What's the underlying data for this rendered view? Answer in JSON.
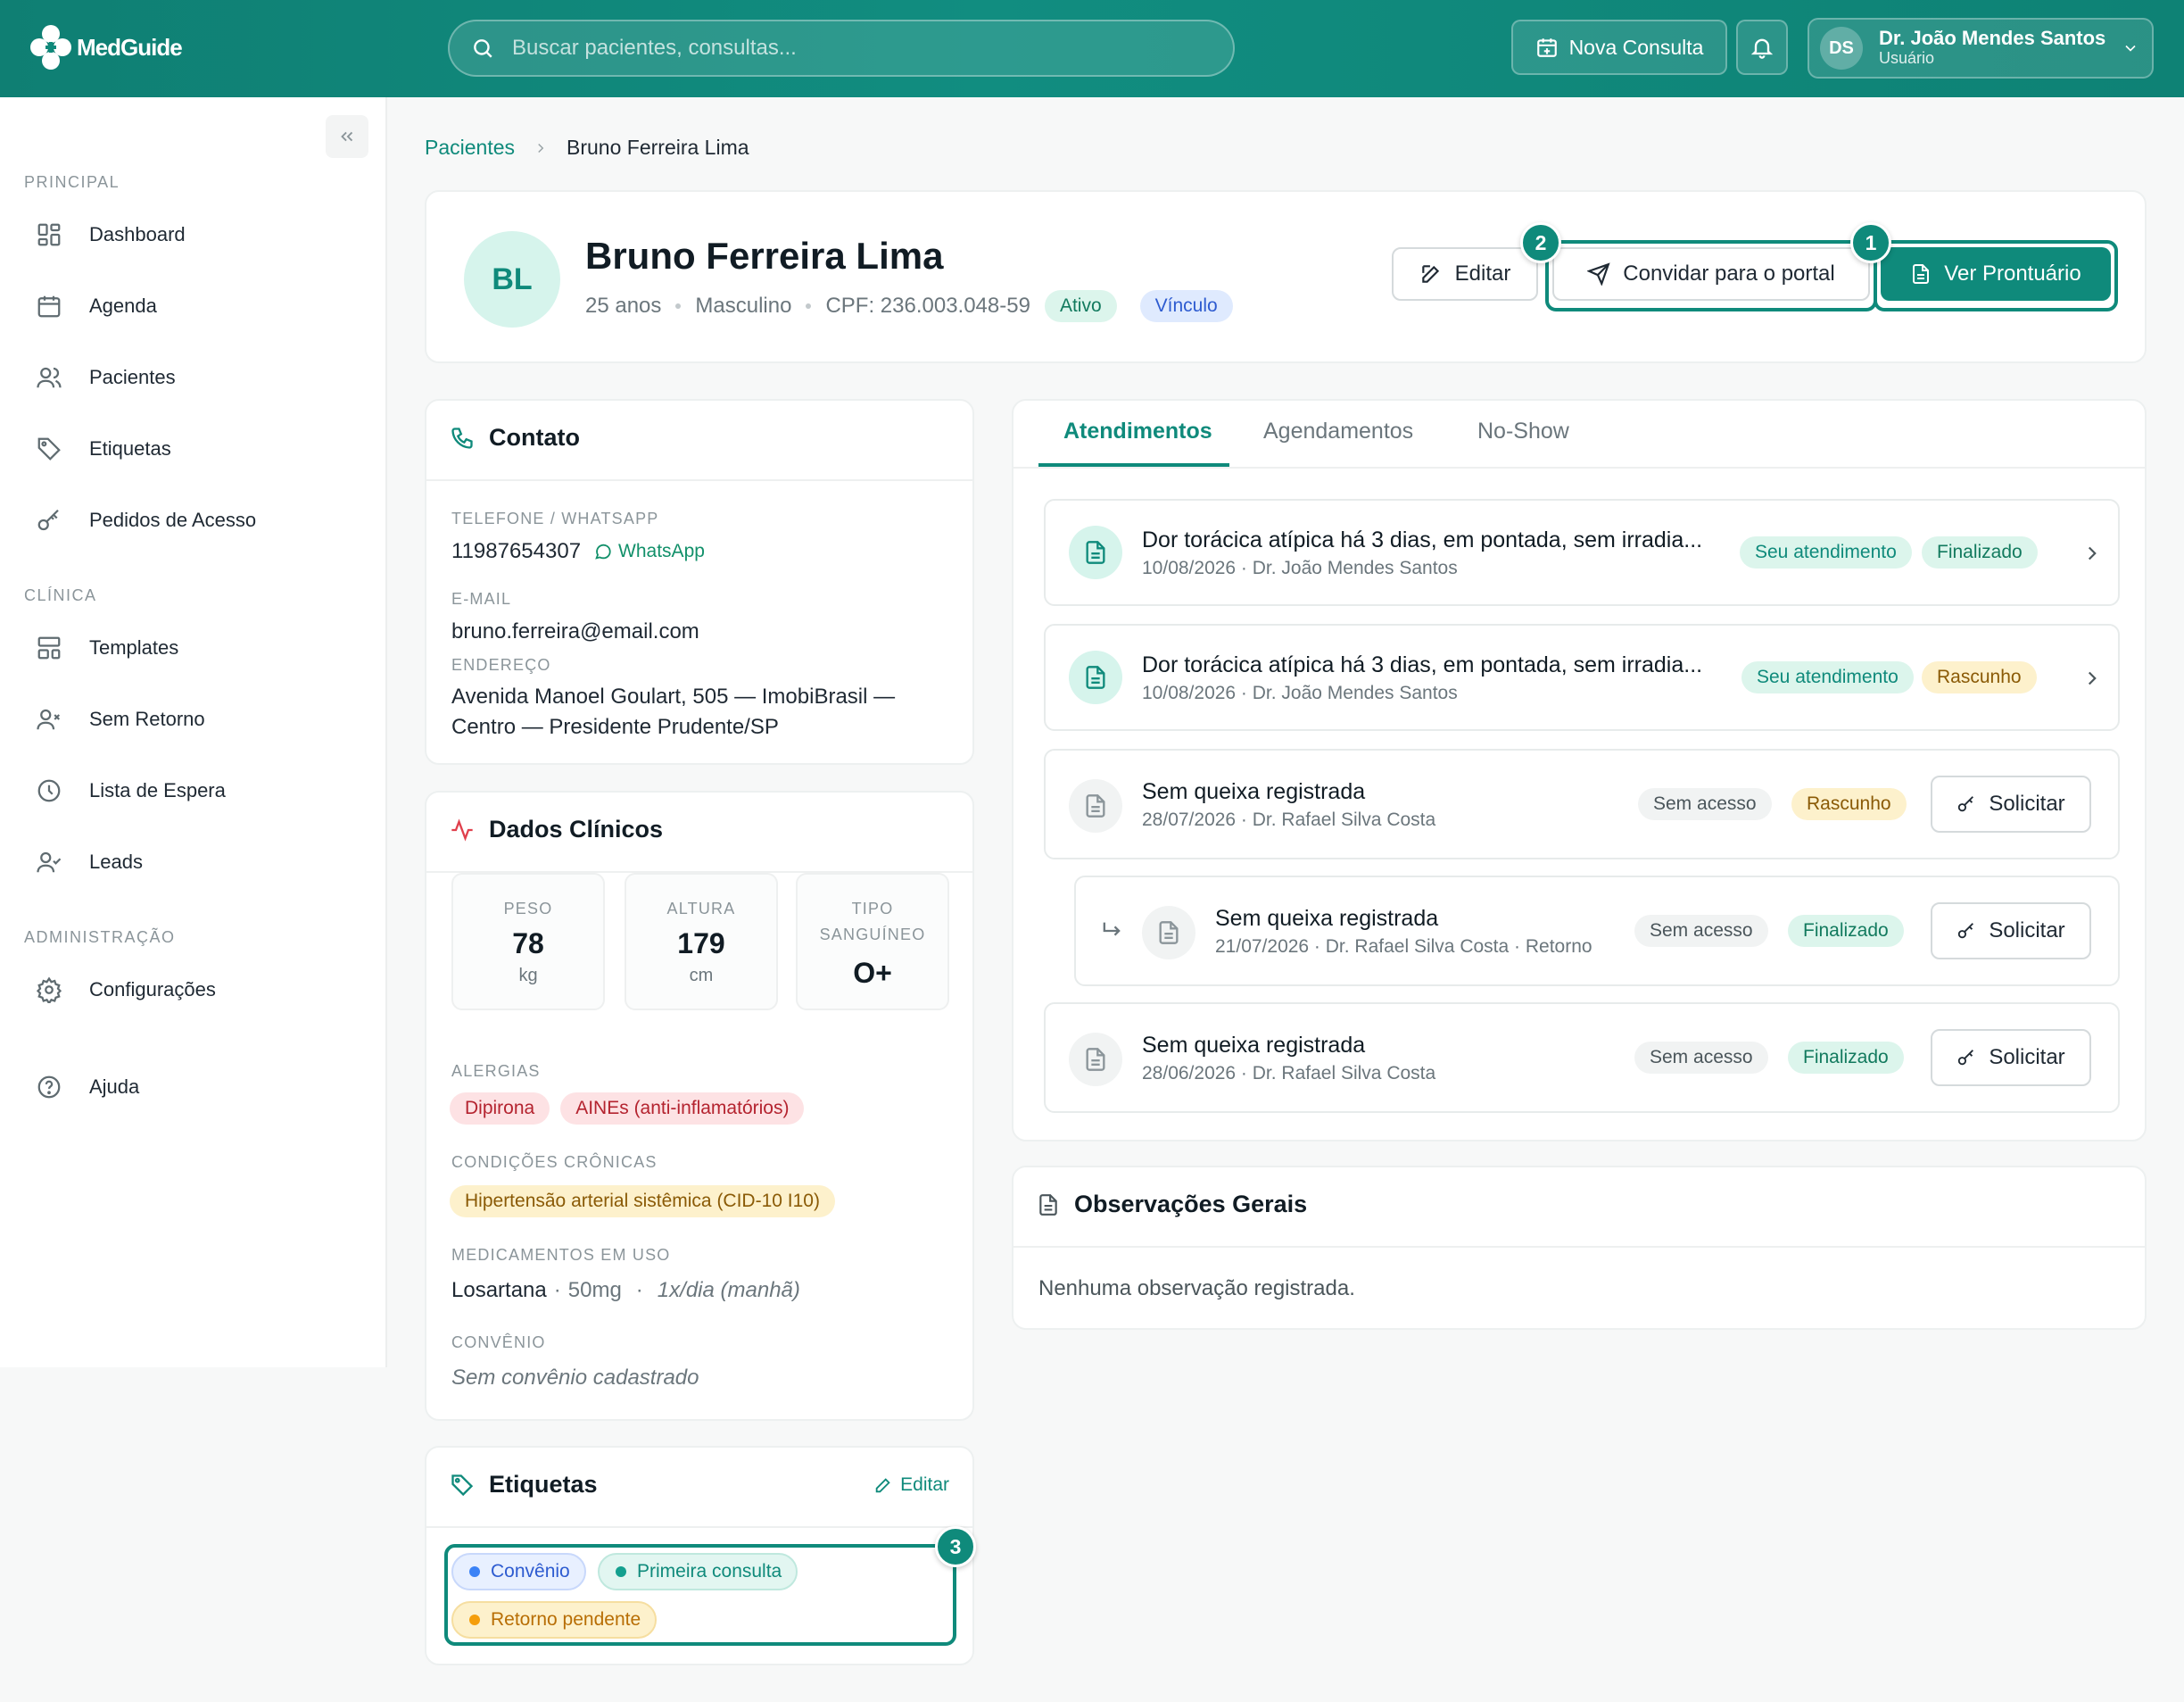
{
  "app": {
    "name": "MedGuide"
  },
  "search": {
    "placeholder": "Buscar pacientes, consultas..."
  },
  "topbar": {
    "new_consult": "Nova Consulta",
    "user_initials": "DS",
    "user_name": "Dr. João Mendes Santos",
    "user_role": "Usuário"
  },
  "sidebar": {
    "sections": [
      "PRINCIPAL",
      "CLÍNICA",
      "ADMINISTRAÇÃO"
    ],
    "items": [
      "Dashboard",
      "Agenda",
      "Pacientes",
      "Etiquetas",
      "Pedidos de Acesso",
      "Templates",
      "Sem Retorno",
      "Lista de Espera",
      "Leads",
      "Configurações",
      "Ajuda"
    ]
  },
  "breadcrumb": {
    "parent": "Pacientes",
    "current": "Bruno Ferreira Lima"
  },
  "patient": {
    "initials": "BL",
    "name": "Bruno Ferreira Lima",
    "age": "25 anos",
    "sex": "Masculino",
    "cpf": "CPF: 236.003.048-59",
    "status": "Ativo",
    "link": "Vínculo"
  },
  "actions": {
    "edit": "Editar",
    "invite": "Convidar para o portal",
    "record": "Ver Prontuário"
  },
  "annotations": [
    "1",
    "2",
    "3"
  ],
  "contact": {
    "title": "Contato",
    "phone_label": "TELEFONE / WHATSAPP",
    "phone": "11987654307",
    "whatsapp": "WhatsApp",
    "email_label": "E-MAIL",
    "email": "bruno.ferreira@email.com",
    "address_label": "ENDEREÇO",
    "address_1": "Avenida Manoel Goulart, 505 — ImobiBrasil —",
    "address_2": "Centro — Presidente Prudente/SP"
  },
  "clinical": {
    "title": "Dados Clínicos",
    "weight_label": "PESO",
    "weight": "78",
    "weight_unit": "kg",
    "height_label": "ALTURA",
    "height": "179",
    "height_unit": "cm",
    "blood_label_1": "TIPO",
    "blood_label_2": "SANGUÍNEO",
    "blood": "O+",
    "allergies_label": "ALERGIAS",
    "allergies": [
      "Dipirona",
      "AINEs (anti-inflamatórios)"
    ],
    "chronic_label": "CONDIÇÕES CRÔNICAS",
    "chronic": "Hipertensão arterial sistêmica (CID-10 I10)",
    "meds_label": "MEDICAMENTOS EM USO",
    "med_name": "Losartana",
    "med_dose": "50mg",
    "med_freq": "1x/dia (manhã)",
    "insurance_label": "CONVÊNIO",
    "insurance": "Sem convênio cadastrado"
  },
  "tags": {
    "title": "Etiquetas",
    "edit": "Editar",
    "items": [
      "Convênio",
      "Primeira consulta",
      "Retorno pendente"
    ],
    "colors": [
      "#3b82f6",
      "#14a08f",
      "#f59e0b"
    ]
  },
  "tabs": [
    "Atendimentos",
    "Agendamentos",
    "No-Show"
  ],
  "appointments": [
    {
      "title": "Dor torácica atípica há 3 dias, em pontada, sem irradia...",
      "meta": "10/08/2026 · Dr. João Mendes Santos",
      "badge1": "Seu atendimento",
      "badge2": "Finalizado"
    },
    {
      "title": "Dor torácica atípica há 3 dias, em pontada, sem irradia...",
      "meta": "10/08/2026 · Dr. João Mendes Santos",
      "badge1": "Seu atendimento",
      "badge2": "Rascunho"
    },
    {
      "title": "Sem queixa registrada",
      "meta": "28/07/2026 · Dr. Rafael Silva Costa",
      "badge1": "Sem acesso",
      "badge2": "Rascunho",
      "action": "Solicitar"
    },
    {
      "title": "Sem queixa registrada",
      "meta": "21/07/2026 · Dr. Rafael Silva Costa · Retorno",
      "badge1": "Sem acesso",
      "badge2": "Finalizado",
      "action": "Solicitar"
    },
    {
      "title": "Sem queixa registrada",
      "meta": "28/06/2026 · Dr. Rafael Silva Costa",
      "badge1": "Sem acesso",
      "badge2": "Finalizado",
      "action": "Solicitar"
    }
  ],
  "notes": {
    "title": "Observações Gerais",
    "empty": "Nenhuma observação registrada."
  }
}
